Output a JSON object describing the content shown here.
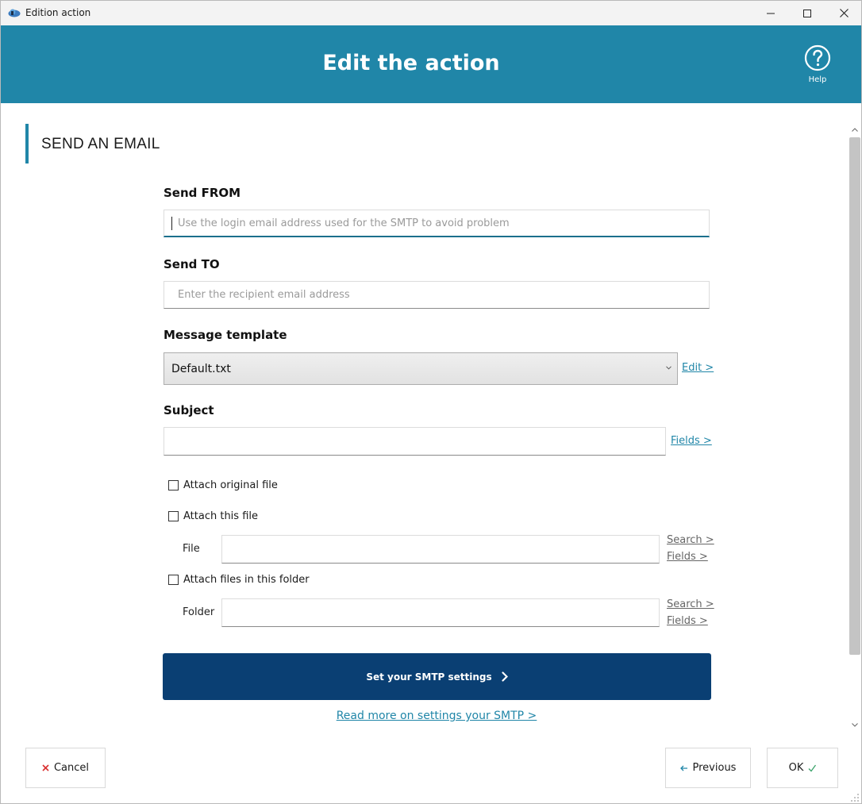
{
  "window": {
    "title": "Edition action",
    "icons": {
      "app": "cloud-app-icon",
      "minimize": "minimize-icon",
      "maximize": "maximize-icon",
      "close": "close-icon"
    }
  },
  "header": {
    "title": "Edit the action",
    "help_label": "Help",
    "background": "#2086a8"
  },
  "section": {
    "title": "SEND AN EMAIL"
  },
  "form": {
    "send_from": {
      "label": "Send FROM",
      "value": "",
      "placeholder": "Use the login email address used for the SMTP to avoid problem"
    },
    "send_to": {
      "label": "Send TO",
      "value": "",
      "placeholder": "Enter the recipient email address"
    },
    "template": {
      "label": "Message template",
      "selected": "Default.txt",
      "edit_link": "Edit >"
    },
    "subject": {
      "label": "Subject",
      "value": "",
      "fields_link": "Fields >"
    },
    "attach_original": {
      "label": "Attach original file",
      "checked": false
    },
    "attach_file": {
      "label": "Attach this file",
      "checked": false,
      "file_label": "File",
      "value": "",
      "search_link": "Search >",
      "fields_link": "Fields >"
    },
    "attach_folder": {
      "label": "Attach files in this folder",
      "checked": false,
      "folder_label": "Folder",
      "value": "",
      "search_link": "Search >",
      "fields_link": "Fields >"
    },
    "smtp_button": "Set your SMTP settings",
    "read_more": "Read more on settings your SMTP >"
  },
  "footer": {
    "cancel": "Cancel",
    "previous": "Previous",
    "ok": "OK"
  },
  "colors": {
    "accent": "#2086a8",
    "smtp_button": "#0a3f73",
    "cancel_icon": "#d93030",
    "ok_check": "#3aa36a"
  }
}
